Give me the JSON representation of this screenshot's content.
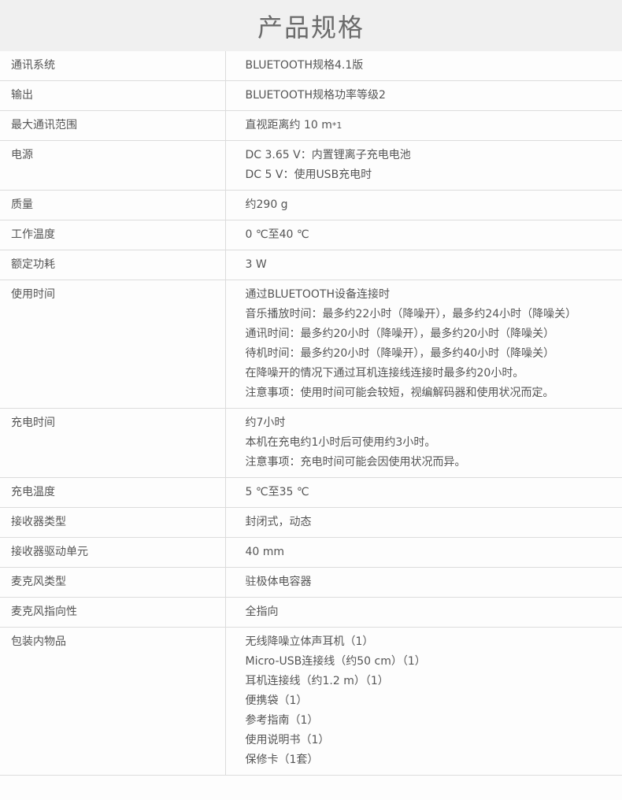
{
  "title": "产品规格",
  "rows": [
    {
      "label": "通讯系统",
      "lines": [
        "BLUETOOTH规格4.1版"
      ]
    },
    {
      "label": "输出",
      "lines": [
        "BLUETOOTH规格功率等级2"
      ]
    },
    {
      "label": "最大通讯范围",
      "main": "直视距离约 10 m",
      "note": "*1"
    },
    {
      "label": "电源",
      "lines": [
        "DC 3.65 V：内置锂离子充电电池",
        "DC 5 V：使用USB充电时"
      ]
    },
    {
      "label": "质量",
      "lines": [
        "约290 g"
      ]
    },
    {
      "label": "工作温度",
      "lines": [
        "0 ℃至40 ℃"
      ]
    },
    {
      "label": "额定功耗",
      "lines": [
        "3 W"
      ]
    },
    {
      "label": "使用时间",
      "lines": [
        "通过BLUETOOTH设备连接时",
        "音乐播放时间：最多约22小时（降噪开），最多约24小时（降噪关）",
        "通讯时间：最多约20小时（降噪开），最多约20小时（降噪关）",
        "待机时间：最多约20小时（降噪开），最多约40小时（降噪关）",
        "在降噪开的情况下通过耳机连接线连接时最多约20小时。",
        "注意事项：使用时间可能会较短，视编解码器和使用状况而定。"
      ]
    },
    {
      "label": "充电时间",
      "lines": [
        "约7小时",
        "本机在充电约1小时后可使用约3小时。",
        "注意事项：充电时间可能会因使用状况而异。"
      ]
    },
    {
      "label": "充电温度",
      "lines": [
        "5 ℃至35 ℃"
      ]
    },
    {
      "label": "接收器类型",
      "lines": [
        "封闭式，动态"
      ]
    },
    {
      "label": "接收器驱动单元",
      "lines": [
        "40 mm"
      ]
    },
    {
      "label": "麦克风类型",
      "lines": [
        "驻极体电容器"
      ]
    },
    {
      "label": "麦克风指向性",
      "lines": [
        "全指向"
      ]
    },
    {
      "label": "包装内物品",
      "lines": [
        "无线降噪立体声耳机（1）",
        "Micro-USB连接线（约50 cm）（1）",
        "耳机连接线（约1.2 m）（1）",
        "便携袋（1）",
        "参考指南（1）",
        "使用说明书（1）",
        "保修卡（1套）"
      ]
    }
  ]
}
